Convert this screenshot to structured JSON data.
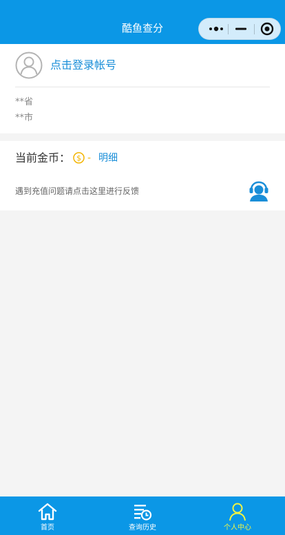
{
  "navbar": {
    "title": "酷鱼查分"
  },
  "profile": {
    "login_link": "点击登录帐号",
    "province": "**省",
    "city": "**市"
  },
  "coins": {
    "label": "当前金币：",
    "value": "-",
    "detail_link": "明细"
  },
  "feedback": {
    "text": "遇到充值问题请点击这里进行反馈"
  },
  "tabbar": {
    "tabs": [
      {
        "label": "首页",
        "icon": "home-icon",
        "active": false
      },
      {
        "label": "查询历史",
        "icon": "history-icon",
        "active": false
      },
      {
        "label": "个人中心",
        "icon": "user-icon",
        "active": true
      }
    ]
  },
  "colors": {
    "primary": "#0b97e6",
    "link": "#1a8ed8",
    "coin": "#f3b400",
    "active_tab": "#f2f542",
    "background": "#f4f4f4"
  }
}
